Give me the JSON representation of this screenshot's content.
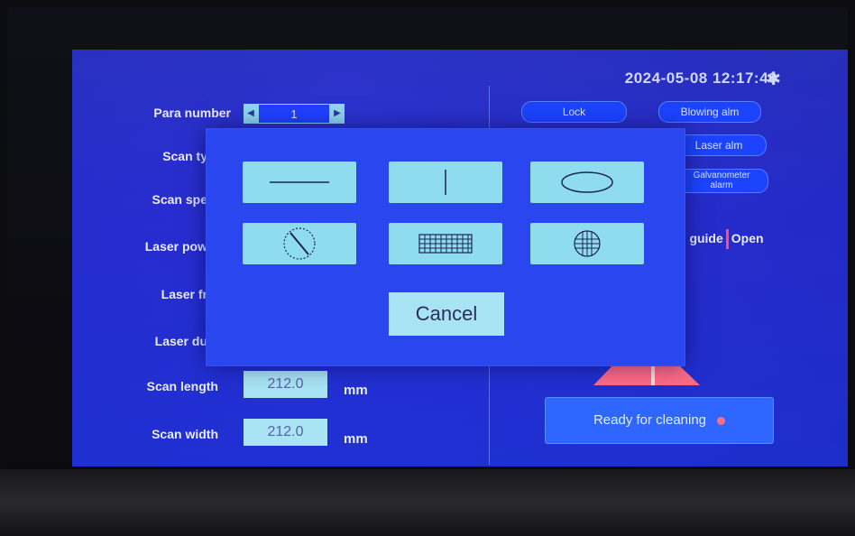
{
  "status_bar": {
    "datetime": "2024-05-08 12:17:40",
    "bluetooth_icon": "bluetooth-icon"
  },
  "pills": {
    "lock": "Lock",
    "blowing_alarm": "Blowing alm",
    "laser_alarm": "Laser alm",
    "galvanometer_alarm_line1": "Galvanometer",
    "galvanometer_alarm_line2": "alarm"
  },
  "params": {
    "para_number_label": "Para number",
    "para_number_value": "1",
    "scan_type_label": "Scan ty",
    "scan_speed_label": "Scan spe",
    "laser_power_label": "Laser pow",
    "laser_freq_label": "Laser fr",
    "laser_duty_label": "Laser du",
    "scan_length_label": "Scan length",
    "scan_length_value": "212.0",
    "scan_length_unit": "mm",
    "scan_width_label": "Scan width",
    "scan_width_value": "212.0",
    "scan_width_unit": "mm"
  },
  "guide": {
    "label": "d guide",
    "value": "Open"
  },
  "ready_button": {
    "label": "Ready for cleaning"
  },
  "scan_type_dialog": {
    "options": [
      "horizontal-line",
      "vertical-line",
      "ellipse",
      "circle-with-diagonal-line",
      "rectangle-grid",
      "circular-grid"
    ],
    "cancel_label": "Cancel"
  },
  "colors": {
    "screen": "#2a2fd8",
    "tile": "#8fdcef",
    "accent": "#ff6d88"
  }
}
